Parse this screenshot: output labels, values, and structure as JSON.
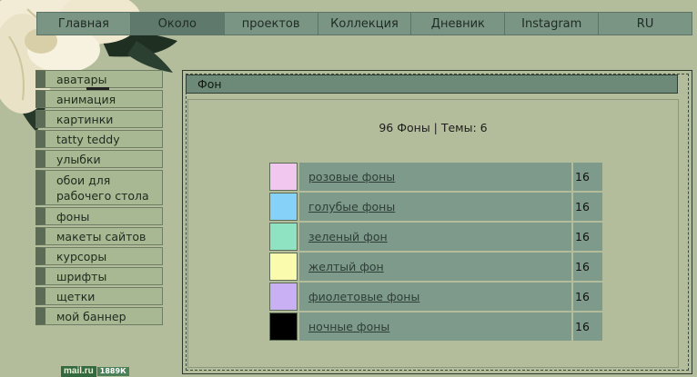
{
  "nav": [
    "Главная",
    "Около",
    "проектов",
    "Коллекция",
    "Дневник",
    "Instagram",
    "RU"
  ],
  "sidebar": [
    "аватары",
    "анимация",
    "картинки",
    "tatty teddy",
    "улыбки",
    "обои для рабочего стола",
    "фоны",
    "макеты сайтов",
    "курсоры",
    "шрифты",
    "щетки",
    "мой баннер"
  ],
  "badge": {
    "logo": "mail.ru",
    "count": "1889К"
  },
  "panel": {
    "title": "Фон",
    "summary": "96 Фоны | Темы: 6"
  },
  "categories": [
    {
      "label": "розовые фоны",
      "count": "16",
      "color": "#f1c6ef"
    },
    {
      "label": "голубые фоны",
      "count": "16",
      "color": "#85d1f7"
    },
    {
      "label": "зеленый фон",
      "count": "16",
      "color": "#8fe3c2"
    },
    {
      "label": "желтый фон",
      "count": "16",
      "color": "#fbfbae"
    },
    {
      "label": "фиолетовые фоны",
      "count": "16",
      "color": "#c9b0f4"
    },
    {
      "label": "ночные фоны",
      "count": "16",
      "color": "#000000"
    }
  ]
}
